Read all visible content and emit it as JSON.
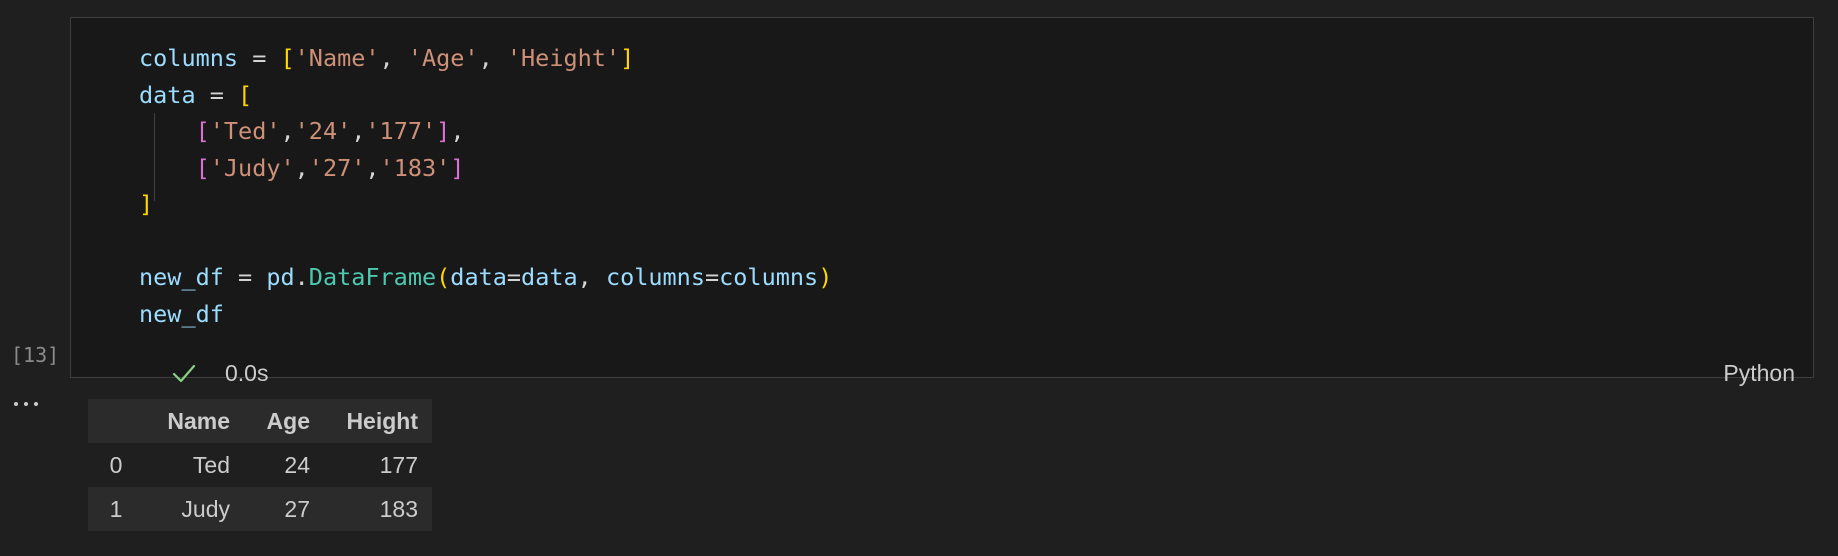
{
  "cell": {
    "code_lines": [
      [
        {
          "t": "columns",
          "k": "var"
        },
        {
          "t": " = ",
          "k": "op"
        },
        {
          "t": "[",
          "k": "b1"
        },
        {
          "t": "'Name'",
          "k": "str"
        },
        {
          "t": ", ",
          "k": "op"
        },
        {
          "t": "'Age'",
          "k": "str"
        },
        {
          "t": ", ",
          "k": "op"
        },
        {
          "t": "'Height'",
          "k": "str"
        },
        {
          "t": "]",
          "k": "b1"
        }
      ],
      [
        {
          "t": "data",
          "k": "var"
        },
        {
          "t": " = ",
          "k": "op"
        },
        {
          "t": "[",
          "k": "b1"
        }
      ],
      [
        {
          "t": "    ",
          "k": "op"
        },
        {
          "t": "[",
          "k": "b2"
        },
        {
          "t": "'Ted'",
          "k": "str"
        },
        {
          "t": ",",
          "k": "op"
        },
        {
          "t": "'24'",
          "k": "str"
        },
        {
          "t": ",",
          "k": "op"
        },
        {
          "t": "'177'",
          "k": "str"
        },
        {
          "t": "]",
          "k": "b2"
        },
        {
          "t": ",",
          "k": "op"
        }
      ],
      [
        {
          "t": "    ",
          "k": "op"
        },
        {
          "t": "[",
          "k": "b2"
        },
        {
          "t": "'Judy'",
          "k": "str"
        },
        {
          "t": ",",
          "k": "op"
        },
        {
          "t": "'27'",
          "k": "str"
        },
        {
          "t": ",",
          "k": "op"
        },
        {
          "t": "'183'",
          "k": "str"
        },
        {
          "t": "]",
          "k": "b2"
        }
      ],
      [
        {
          "t": "]",
          "k": "b1"
        }
      ],
      [],
      [
        {
          "t": "new_df",
          "k": "var"
        },
        {
          "t": " = ",
          "k": "op"
        },
        {
          "t": "pd",
          "k": "var"
        },
        {
          "t": ".",
          "k": "op"
        },
        {
          "t": "DataFrame",
          "k": "fn"
        },
        {
          "t": "(",
          "k": "b1"
        },
        {
          "t": "data",
          "k": "var"
        },
        {
          "t": "=",
          "k": "op"
        },
        {
          "t": "data",
          "k": "var"
        },
        {
          "t": ", ",
          "k": "op"
        },
        {
          "t": "columns",
          "k": "var"
        },
        {
          "t": "=",
          "k": "op"
        },
        {
          "t": "columns",
          "k": "var"
        },
        {
          "t": ")",
          "k": "b1"
        }
      ],
      [
        {
          "t": "new_df",
          "k": "var"
        }
      ]
    ],
    "execution_count": "[13]",
    "status_icon": "checkmark-icon",
    "duration": "0.0s",
    "language": "Python"
  },
  "output": {
    "ellipsis_icon": "more-horizontal-icon",
    "table": {
      "columns": [
        "",
        "Name",
        "Age",
        "Height"
      ],
      "rows": [
        {
          "index": "0",
          "values": [
            "Ted",
            "24",
            "177"
          ]
        },
        {
          "index": "1",
          "values": [
            "Judy",
            "27",
            "183"
          ]
        }
      ]
    }
  },
  "colors": {
    "background": "#1f1f1f",
    "cell_background": "#181818",
    "cell_border": "#3e3e3e",
    "check": "#89d185",
    "string": "#ce9178",
    "variable": "#9cdcfe",
    "function": "#4ec9b0",
    "bracket_1": "#ffd700",
    "bracket_2": "#da70d6",
    "table_header_bg": "#2b2b2b"
  }
}
